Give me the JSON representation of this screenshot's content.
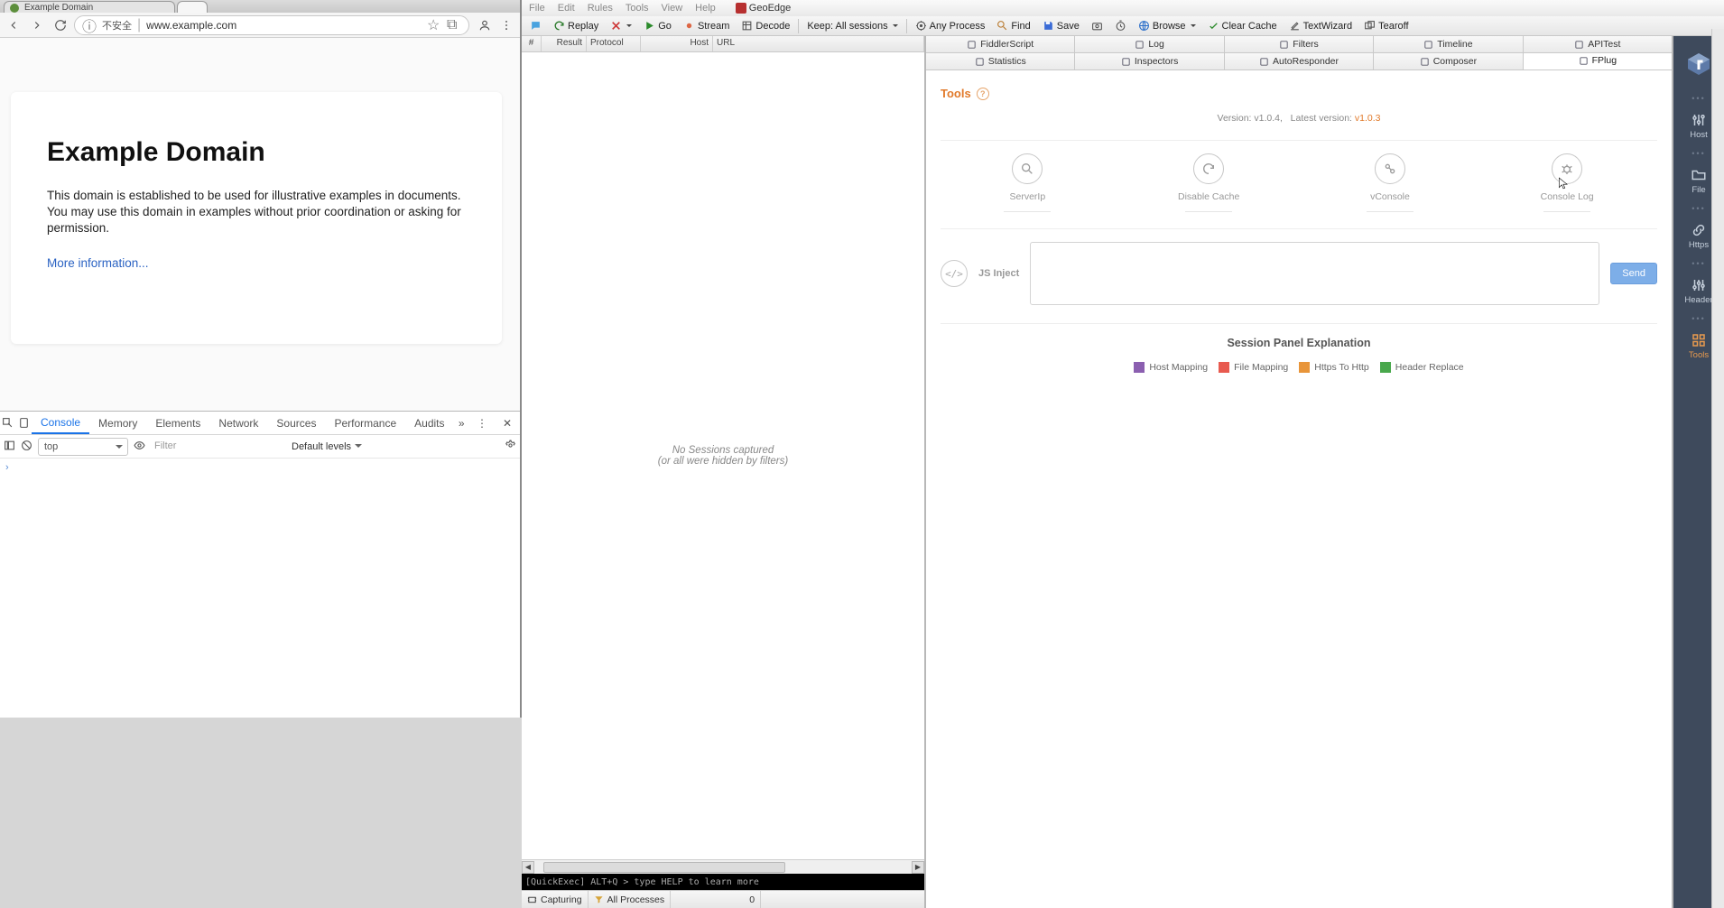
{
  "browser": {
    "tab_title": "Example Domain",
    "insecure_label": "不安全",
    "url": "www.example.com",
    "page": {
      "heading": "Example Domain",
      "body": "This domain is established to be used for illustrative examples in documents. You may use this domain in examples without prior coordination or asking for permission.",
      "link": "More information..."
    }
  },
  "devtools": {
    "tabs": [
      "Console",
      "Memory",
      "Elements",
      "Network",
      "Sources",
      "Performance",
      "Audits"
    ],
    "context": "top",
    "filter_placeholder": "Filter",
    "levels": "Default levels"
  },
  "fiddler": {
    "menus": [
      "File",
      "Edit",
      "Rules",
      "Tools",
      "View",
      "Help"
    ],
    "geoedge": "GeoEdge",
    "toolbar": {
      "replay": "Replay",
      "go": "Go",
      "stream": "Stream",
      "decode": "Decode",
      "keep": "Keep: All sessions",
      "any_process": "Any Process",
      "find": "Find",
      "save": "Save",
      "browse": "Browse",
      "clear_cache": "Clear Cache",
      "textwizard": "TextWizard",
      "tearoff": "Tearoff"
    },
    "session_cols": {
      "num": "#",
      "result": "Result",
      "protocol": "Protocol",
      "host": "Host",
      "url": "URL"
    },
    "empty1": "No Sessions captured",
    "empty2": "(or all were hidden by filters)",
    "quickexec": "[QuickExec] ALT+Q > type HELP to learn more",
    "status": {
      "capturing": "Capturing",
      "all_proc": "All Processes",
      "count": "0"
    },
    "tabs_row1": [
      "FiddlerScript",
      "Log",
      "Filters",
      "Timeline",
      "APITest"
    ],
    "tabs_row2": [
      "Statistics",
      "Inspectors",
      "AutoResponder",
      "Composer",
      "FPlug"
    ],
    "fplug": {
      "title": "Tools",
      "version_label": "Version: ",
      "version": "v1.0.4, ",
      "latest_label": "Latest version: ",
      "latest": "v1.0.3",
      "tools": [
        "ServerIp",
        "Disable Cache",
        "vConsole",
        "Console Log"
      ],
      "js_inject": "JS Inject",
      "send": "Send",
      "section": "Session Panel Explanation",
      "legend": [
        {
          "c": "#8b5fb0",
          "t": "Host Mapping"
        },
        {
          "c": "#e85a4f",
          "t": "File Mapping"
        },
        {
          "c": "#e8953a",
          "t": "Https To Http"
        },
        {
          "c": "#49a84c",
          "t": "Header Replace"
        }
      ]
    },
    "rail": [
      "Host",
      "File",
      "Https",
      "Header",
      "Tools"
    ]
  }
}
